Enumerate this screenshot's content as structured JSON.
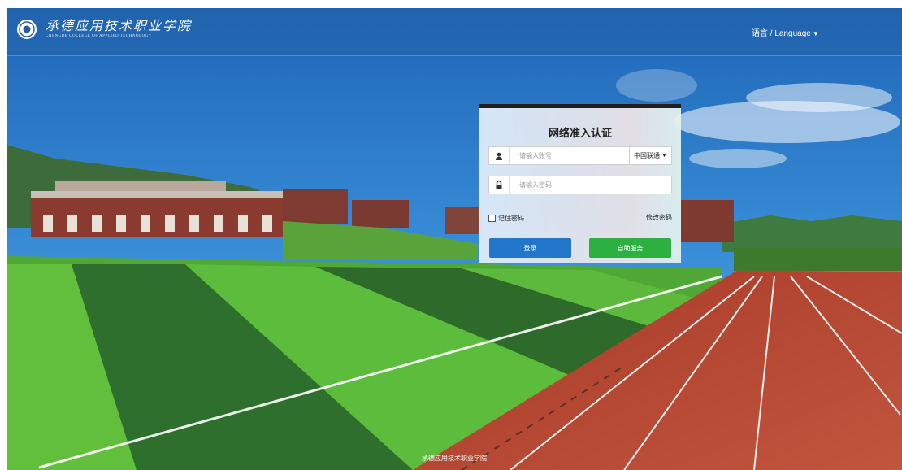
{
  "header": {
    "logo_cn": "承德应用技术职业学院",
    "logo_en": "CHENGDE COLLEGE OF APPLIED TECHNOLOGY",
    "language_label": "语言 / Language"
  },
  "login": {
    "title": "网络准入认证",
    "account_placeholder": "请输入账号",
    "carrier_selected": "中国联通",
    "password_placeholder": "请输入密码",
    "remember_label": "记住密码",
    "change_password_label": "修改密码",
    "login_button": "登录",
    "self_service_button": "自助服务"
  },
  "footer": {
    "text": "承德应用技术职业学院"
  },
  "colors": {
    "login_button": "#2277cc",
    "self_service_button": "#2db042",
    "card_top_border": "#1f1f1f"
  },
  "icons": [
    "emblem-icon",
    "chevron-down-icon",
    "user-icon",
    "lock-icon"
  ]
}
